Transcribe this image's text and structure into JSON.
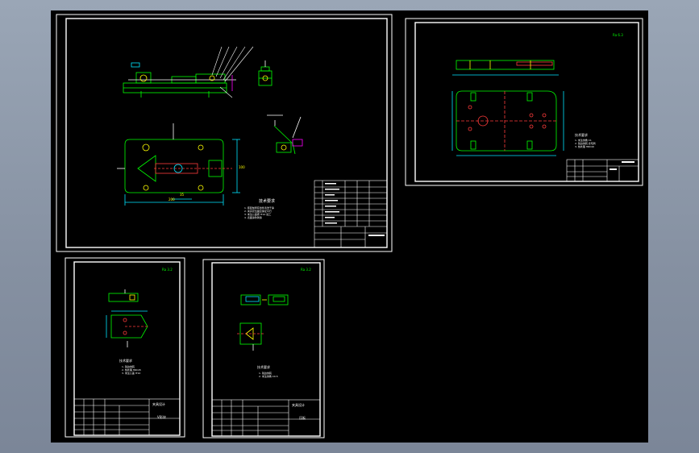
{
  "viewport": {
    "background": "#000000"
  },
  "colors": {
    "border": "#ffffff",
    "part": "#00ff00",
    "hole": "#ff3b3b",
    "dim": "#00e5ff",
    "text": "#ffffff",
    "accent": "#ffff00",
    "magenta": "#ff00ff"
  },
  "sheets": {
    "assembly": {
      "notes_title": "技术要求",
      "notes": [
        "1. 装配前所有零件清洗干净",
        "2. 夹具定位面应保证平行",
        "3. 未注公差按 IT12 加工",
        "4. 表面涂防锈漆"
      ],
      "dims": {
        "width": "200",
        "height": "100",
        "offset": "35"
      }
    },
    "base_plate": {
      "roughness": "Ra 6.3",
      "notes_title": "技术要求",
      "notes": [
        "1. 未注倒角 C1",
        "2. 锐边倒钝 去毛刺",
        "3. 热处理 HRC40"
      ]
    },
    "part_a": {
      "roughness": "Ra 3.2",
      "notes_title": "技术要求",
      "notes": [
        "1. 锐边倒钝",
        "2. 热处理 HRC45",
        "3. 未注公差 IT12"
      ],
      "title": "夹具设计",
      "name": "V形块"
    },
    "part_b": {
      "roughness": "Ra 3.2",
      "notes_title": "技术要求",
      "notes": [
        "1. 锐边倒钝",
        "2. 未注倒角 C0.5"
      ],
      "title": "夹具设计",
      "name": "压板"
    }
  }
}
